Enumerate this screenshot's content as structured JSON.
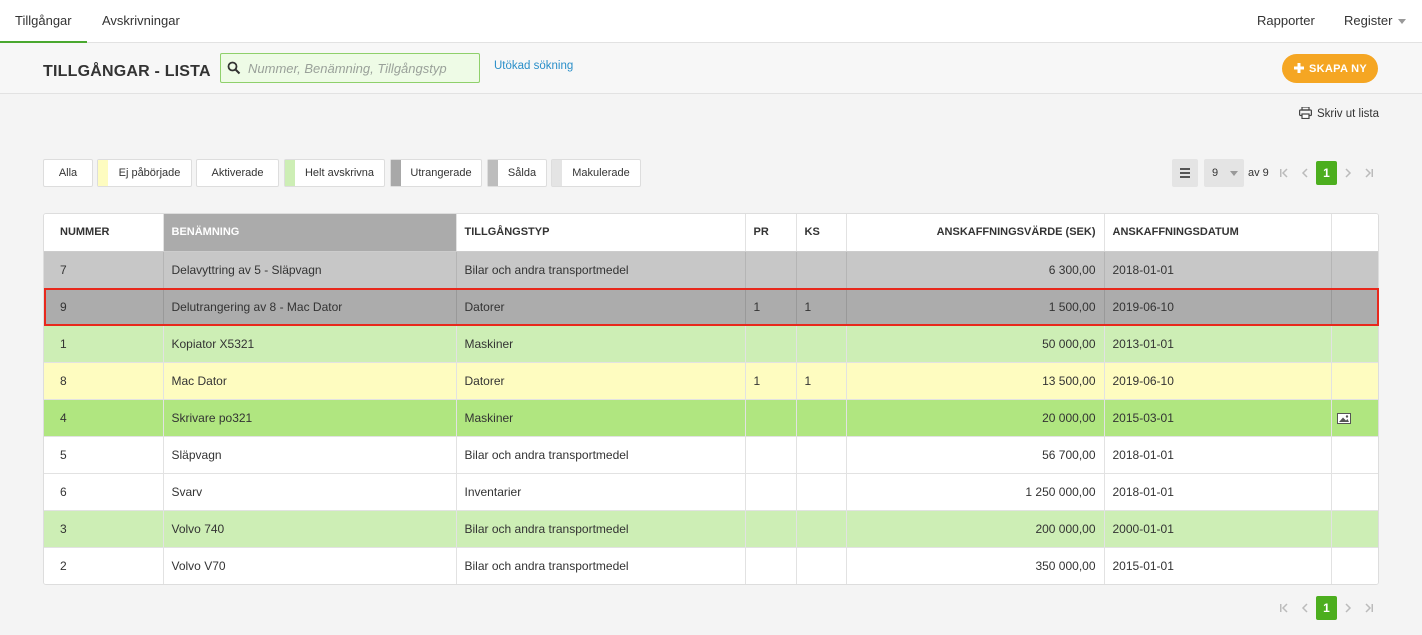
{
  "nav": {
    "tabs": [
      {
        "label": "Tillgångar",
        "active": true
      },
      {
        "label": "Avskrivningar",
        "active": false
      }
    ],
    "right": [
      {
        "label": "Rapporter"
      },
      {
        "label": "Register"
      }
    ]
  },
  "header": {
    "title": "TILLGÅNGAR - LISTA",
    "search_placeholder": "Nummer, Benämning, Tillgångstyp",
    "search_value": "",
    "advanced_link": "Utökad sökning",
    "create_label": "SKAPA NY"
  },
  "toolbar": {
    "print_label": "Skriv ut lista"
  },
  "filters": [
    {
      "label": "Alla"
    },
    {
      "label": "Ej påbörjade",
      "color": "#fefcc0"
    },
    {
      "label": "Aktiverade"
    },
    {
      "label": "Helt avskrivna",
      "color": "#cdeeb5"
    },
    {
      "label": "Utrangerade",
      "color": "#a8a8a8"
    },
    {
      "label": "Sålda",
      "color": "#bdbdbd"
    },
    {
      "label": "Makulerade",
      "color": "#e4e4e4"
    }
  ],
  "pager": {
    "per_page": "9",
    "of_label": "av 9",
    "current_page": "1"
  },
  "colors": {
    "accent_green": "#4cae1e",
    "create_orange": "#f5a623",
    "link_blue": "#2a8fc9",
    "selection_red": "#e8281c"
  },
  "table": {
    "columns": [
      "NUMMER",
      "BENÄMNING",
      "TILLGÅNGSTYP",
      "PR",
      "KS",
      "ANSKAFFNINGSVÄRDE (SEK)",
      "ANSKAFFNINGSDATUM",
      ""
    ],
    "sorted_column": "BENÄMNING",
    "rows": [
      {
        "status": "utrangerad",
        "nummer": "7",
        "benamning": "Delavyttring av 5 - Släpvagn",
        "typ": "Bilar och andra transportmedel",
        "pr": "",
        "ks": "",
        "varde": "6 300,00",
        "datum": "2018-01-01",
        "image": false
      },
      {
        "status": "utrangerad-sel",
        "selected": true,
        "nummer": "9",
        "benamning": "Delutrangering av 8 - Mac Dator",
        "typ": "Datorer",
        "pr": "1",
        "ks": "1",
        "varde": "1 500,00",
        "datum": "2019-06-10",
        "image": false
      },
      {
        "status": "helt",
        "nummer": "1",
        "benamning": "Kopiator X5321",
        "typ": "Maskiner",
        "pr": "",
        "ks": "",
        "varde": "50 000,00",
        "datum": "2013-01-01",
        "image": false
      },
      {
        "status": "ej",
        "nummer": "8",
        "benamning": "Mac Dator",
        "typ": "Datorer",
        "pr": "1",
        "ks": "1",
        "varde": "13 500,00",
        "datum": "2019-06-10",
        "image": false
      },
      {
        "status": "aktiv",
        "nummer": "4",
        "benamning": "Skrivare po321",
        "typ": "Maskiner",
        "pr": "",
        "ks": "",
        "varde": "20 000,00",
        "datum": "2015-03-01",
        "image": true
      },
      {
        "status": "normal",
        "nummer": "5",
        "benamning": "Släpvagn",
        "typ": "Bilar och andra transportmedel",
        "pr": "",
        "ks": "",
        "varde": "56 700,00",
        "datum": "2018-01-01",
        "image": false
      },
      {
        "status": "normal",
        "nummer": "6",
        "benamning": "Svarv",
        "typ": "Inventarier",
        "pr": "",
        "ks": "",
        "varde": "1 250 000,00",
        "datum": "2018-01-01",
        "image": false
      },
      {
        "status": "helt",
        "nummer": "3",
        "benamning": "Volvo 740",
        "typ": "Bilar och andra transportmedel",
        "pr": "",
        "ks": "",
        "varde": "200 000,00",
        "datum": "2000-01-01",
        "image": false
      },
      {
        "status": "normal",
        "nummer": "2",
        "benamning": "Volvo V70",
        "typ": "Bilar och andra transportmedel",
        "pr": "",
        "ks": "",
        "varde": "350 000,00",
        "datum": "2015-01-01",
        "image": false
      }
    ]
  }
}
